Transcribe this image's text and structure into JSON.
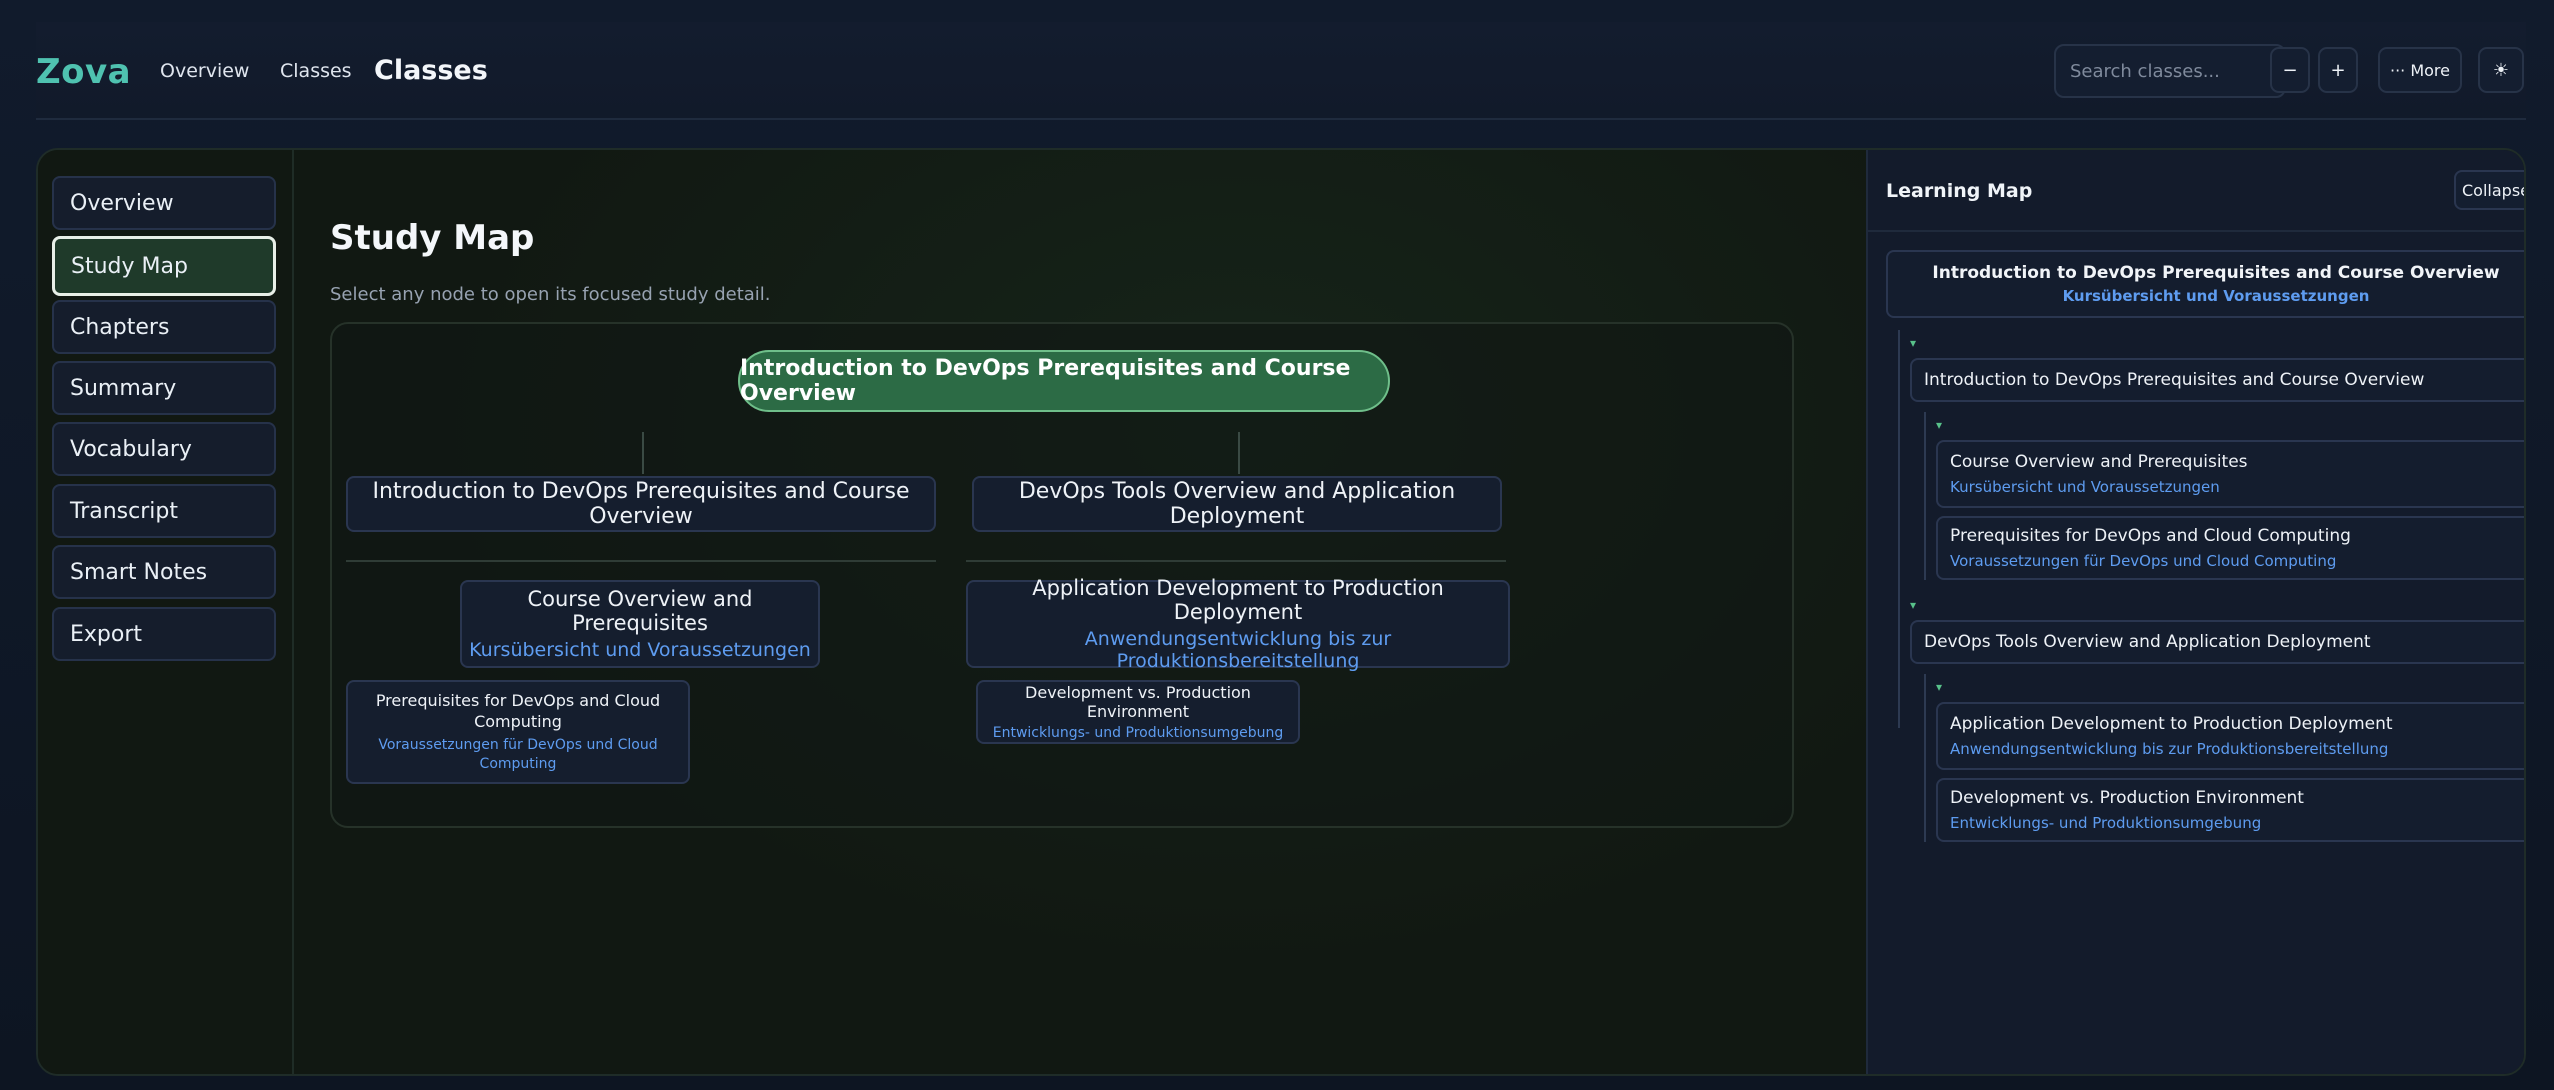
{
  "topbar": {
    "brand": "Zova",
    "nav": [
      "Overview",
      "Classes"
    ],
    "page_title": "Classes",
    "search_placeholder": "Search classes...",
    "zoom_out": "−",
    "zoom_in": "+",
    "more": "··· More",
    "theme_icon": "☀"
  },
  "sidebar": {
    "items": [
      {
        "label": "Overview"
      },
      {
        "label": "Study Map",
        "active": true
      },
      {
        "label": "Chapters"
      },
      {
        "label": "Summary"
      },
      {
        "label": "Vocabulary"
      },
      {
        "label": "Transcript"
      },
      {
        "label": "Smart Notes"
      },
      {
        "label": "Export"
      }
    ]
  },
  "main": {
    "title": "Study Map",
    "subtitle": "Select any node to open its focused study detail.",
    "root": "Introduction to DevOps Prerequisites and Course Overview",
    "branches": [
      {
        "title": "Introduction to DevOps Prerequisites and Course Overview",
        "child": {
          "title": "Course Overview and Prerequisites",
          "subtitle": "Kursübersicht und Voraussetzungen"
        },
        "leaf": {
          "title": "Prerequisites for DevOps and Cloud Computing",
          "subtitle": "Voraussetzungen für DevOps und Cloud Computing"
        }
      },
      {
        "title": "DevOps Tools Overview and Application Deployment",
        "child": {
          "title": "Application Development to Production Deployment",
          "subtitle": "Anwendungsentwicklung bis zur Produktionsbereitstellung"
        },
        "leaf": {
          "title": "Development vs. Production Environment",
          "subtitle": "Entwicklungs- und Produktionsumgebung"
        }
      }
    ]
  },
  "panel": {
    "title": "Learning Map",
    "collapse": "Collapse",
    "caret": "▾",
    "root": {
      "title": "Introduction to DevOps Prerequisites and Course Overview",
      "subtitle": "Kursübersicht und Voraussetzungen"
    },
    "sections": [
      {
        "title": "Introduction to DevOps Prerequisites and Course Overview",
        "items": [
          {
            "title": "Course Overview and Prerequisites",
            "subtitle": "Kursübersicht und Voraussetzungen"
          },
          {
            "title": "Prerequisites for DevOps and Cloud Computing",
            "subtitle": "Voraussetzungen für DevOps und Cloud Computing"
          }
        ]
      },
      {
        "title": "DevOps Tools Overview and Application Deployment",
        "items": [
          {
            "title": "Application Development to Production Deployment",
            "subtitle": "Anwendungsentwicklung bis zur Produktionsbereitstellung"
          },
          {
            "title": "Development vs. Production Environment",
            "subtitle": "Entwicklungs- und Produktionsumgebung"
          }
        ]
      }
    ]
  },
  "colors": {
    "brand": "#4fc2b0",
    "accent_green": "#2c6b45",
    "link_blue": "#5e9cf0"
  }
}
